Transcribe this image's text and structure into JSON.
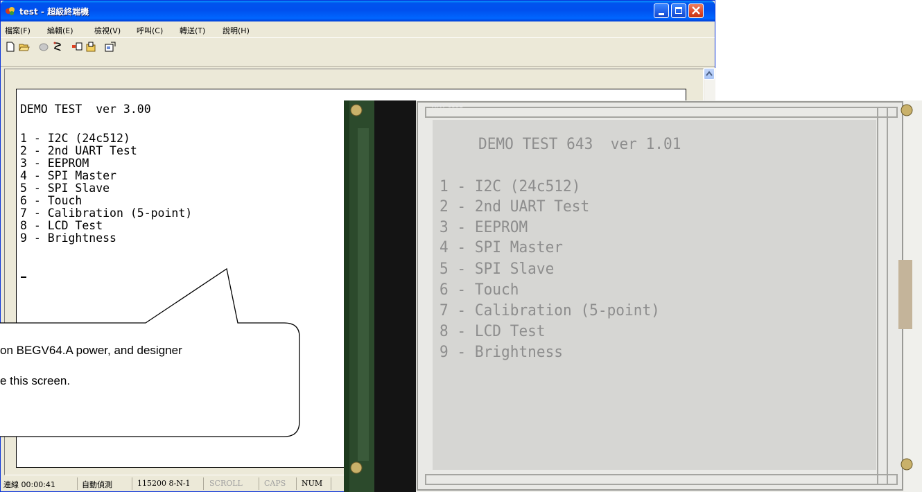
{
  "window": {
    "title": "test - 超級終端機"
  },
  "menu": [
    "檔案(F)",
    "編輯(E)",
    "檢視(V)",
    "呼叫(C)",
    "轉送(T)",
    "說明(H)"
  ],
  "toolbar": {
    "icons": [
      "new-icon",
      "open-icon",
      "disconnect-icon",
      "dial-icon",
      "send-icon",
      "receive-icon",
      "properties-icon"
    ]
  },
  "terminal": {
    "lines": [
      "DEMO TEST  ver 3.00",
      "1 - I2C (24c512)",
      "2 - 2nd UART Test",
      "3 - EEPROM",
      "4 - SPI Master",
      "5 - SPI Slave",
      "6 - Touch",
      "7 - Calibration (5-point)",
      "8 - LCD Test",
      "9 - Brightness"
    ]
  },
  "status": {
    "connection": "連線 00:00:41",
    "detect": "自動偵測",
    "params": "115200 8-N-1",
    "scroll": "SCROLL",
    "caps": "CAPS",
    "num": "NUM"
  },
  "callout": {
    "line1": "on BEGV64.A power, and designer",
    "line2": "e this screen."
  },
  "lcd": {
    "label": "AMY 0532",
    "lines": [
      "DEMO TEST 643  ver 1.01",
      "1 - I2C (24c512)",
      "2 - 2nd UART Test",
      "3 - EEPROM",
      "4 - SPI Master",
      "5 - SPI Slave",
      "6 - Touch",
      "7 - Calibration (5-point)",
      "8 - LCD Test",
      "9 - Brightness"
    ]
  }
}
